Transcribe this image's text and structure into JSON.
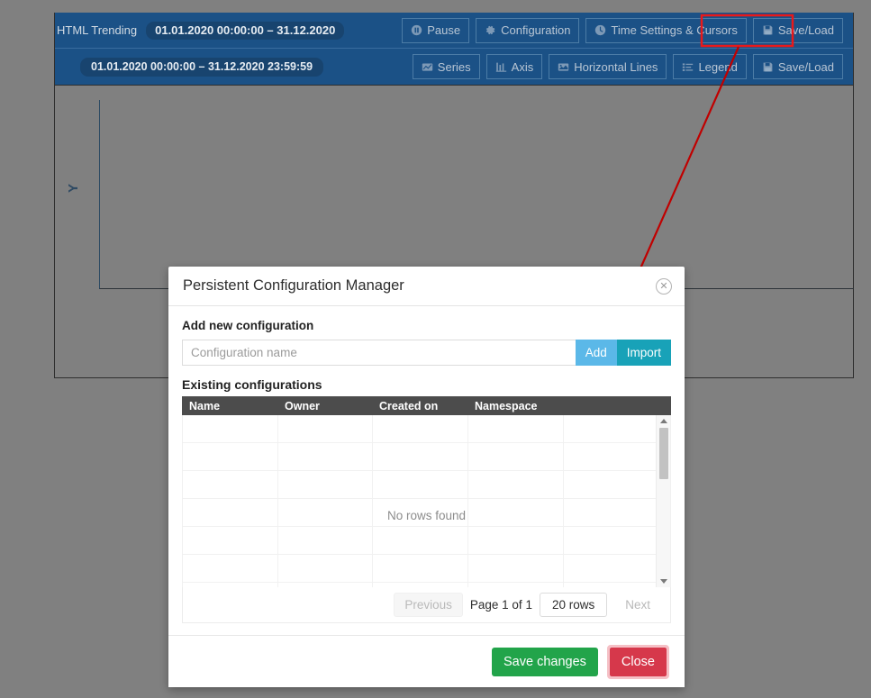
{
  "app": {
    "title": "HTML Trending",
    "time_range_top": "01.01.2020 00:00:00 – 31.12.2020",
    "time_range_second": "01.01.2020 00:00:00 – 31.12.2020 23:59:59",
    "y_axis_label": "Y"
  },
  "toolbar_top": {
    "buttons": [
      {
        "label": "Pause",
        "icon": "pause-icon"
      },
      {
        "label": "Configuration",
        "icon": "gear-icon"
      },
      {
        "label": "Time Settings & Cursors",
        "icon": "clock-icon"
      },
      {
        "label": "Save/Load",
        "icon": "floppy-icon"
      }
    ]
  },
  "toolbar_second": {
    "buttons": [
      {
        "label": "Series",
        "icon": "series-icon"
      },
      {
        "label": "Axis",
        "icon": "axis-icon"
      },
      {
        "label": "Horizontal Lines",
        "icon": "horizontal-lines-icon"
      },
      {
        "label": "Legend",
        "icon": "legend-icon"
      },
      {
        "label": "Save/Load",
        "icon": "floppy-icon"
      }
    ]
  },
  "dialog": {
    "title": "Persistent Configuration Manager",
    "close_icon": "circle-x-icon",
    "add_section": {
      "label": "Add new configuration",
      "input_value": "",
      "input_placeholder": "Configuration name",
      "add_label": "Add",
      "import_label": "Import"
    },
    "existing_section": {
      "label": "Existing configurations",
      "columns": [
        "Name",
        "Owner",
        "Created on",
        "Namespace",
        ""
      ],
      "rows": [],
      "empty_message": "No rows found"
    },
    "pagination": {
      "previous_label": "Previous",
      "page_label": "Page 1 of 1",
      "rows_per_page": "20 rows",
      "next_label": "Next"
    },
    "footer": {
      "save_label": "Save changes",
      "close_label": "Close"
    }
  },
  "annotation": {
    "highlight_color": "#e8191a",
    "target": "Save/Load"
  }
}
